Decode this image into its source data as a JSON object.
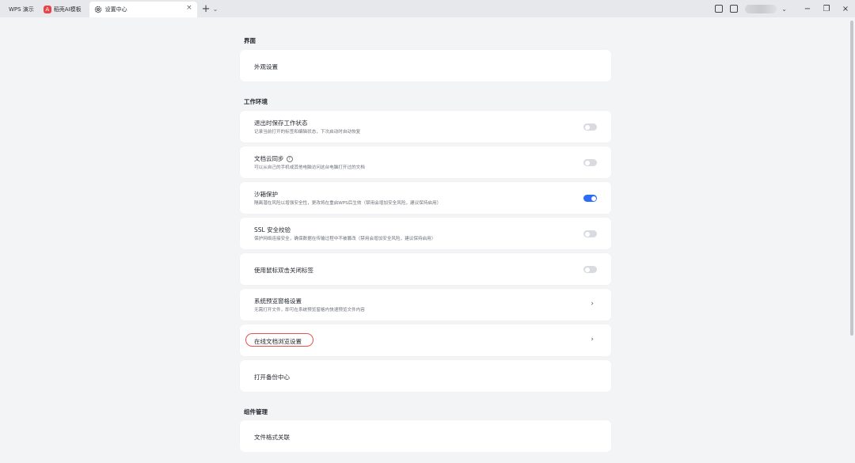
{
  "tabs": {
    "wps_label": "WPS 演示",
    "ai_label": "稻壳AI模板",
    "ai_logo_text": "A",
    "active_label": "设置中心",
    "close_glyph": "×",
    "add_glyph": "+",
    "dropdown_glyph": "⌄"
  },
  "window": {
    "minimize": "−",
    "restore": "❐",
    "close": "×",
    "caret": "⌄"
  },
  "sections": {
    "interface": "界面",
    "workspace": "工作环境",
    "components": "组件管理"
  },
  "items": {
    "appearance": {
      "title": "外观设置"
    },
    "save_state": {
      "title": "退出时保存工作状态",
      "desc": "记录当前打开的标签和编辑状态，下次启动时自动恢复",
      "on": false
    },
    "cloud_sync": {
      "title": "文档云同步",
      "help": "?",
      "desc": "可以从自己的手机或其他电脑访问这台电脑打开过的文档",
      "on": false
    },
    "sandbox": {
      "title": "沙箱保护",
      "desc": "隔离潜在风险以增强安全性，更改将在重启WPS后生效（禁用会增加安全风险，建议保持启用）",
      "on": true
    },
    "ssl": {
      "title": "SSL 安全校验",
      "desc": "保护网络连接安全，确保数据在传输过程中不被篡改（禁用会增加安全风险，建议保持启用）",
      "on": false
    },
    "double_click": {
      "title": "使用鼠标双击关闭标签",
      "on": false
    },
    "preview_pane": {
      "title": "系统预览窗格设置",
      "desc": "无需打开文件，即可在系统预览窗格内快速预览文件内容",
      "chevron": "›"
    },
    "online_browse": {
      "title": "在线文档浏览设置",
      "chevron": "›"
    },
    "backup": {
      "title": "打开备份中心"
    },
    "file_assoc": {
      "title": "文件格式关联"
    }
  },
  "colors": {
    "toggle_on": "#2f6cf5",
    "highlight": "#e5534b"
  }
}
